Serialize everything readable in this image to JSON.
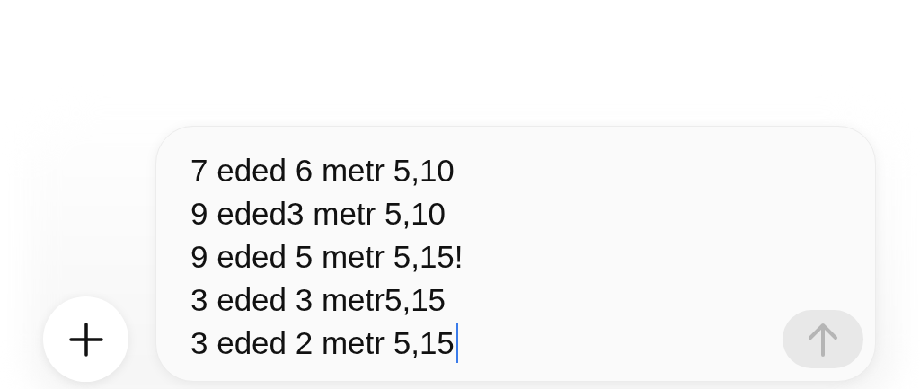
{
  "composer": {
    "lines": [
      "7 eded 6 metr 5,10",
      "9 eded3 metr 5,10",
      "9 eded 5 metr 5,15!",
      "3 eded 3 metr5,15",
      "3 eded 2 metr 5,15"
    ],
    "send_button": {
      "disabled": true
    }
  }
}
